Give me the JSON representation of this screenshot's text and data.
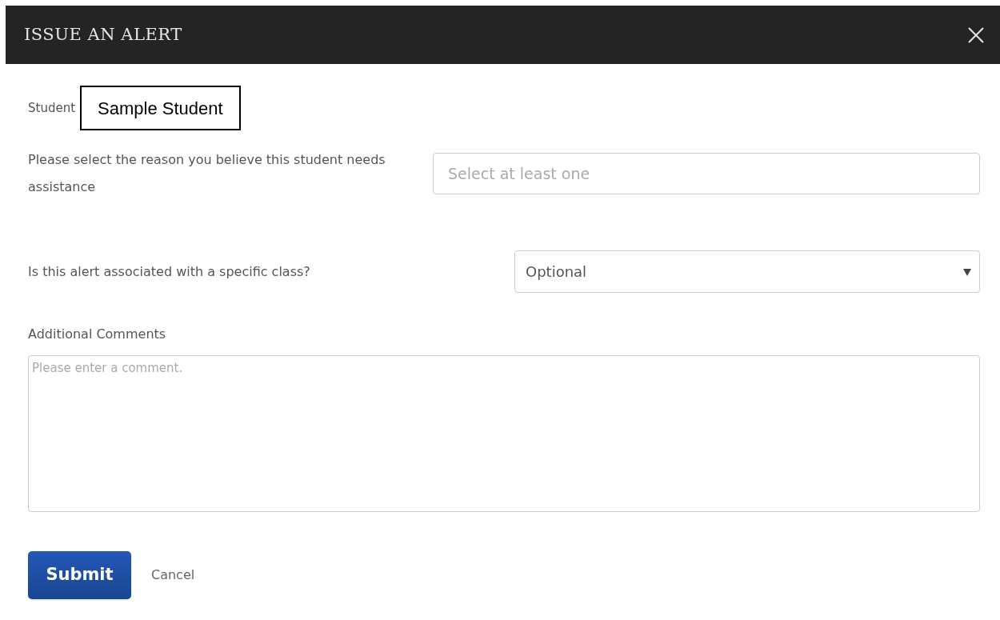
{
  "dialog": {
    "title": "ISSUE AN ALERT"
  },
  "student": {
    "label": "Student",
    "value": "Sample Student"
  },
  "reason": {
    "label": "Please select the reason you believe this student needs assistance",
    "placeholder": "Select at least one"
  },
  "class_select": {
    "label": "Is this alert associated with a specific class?",
    "value": "Optional"
  },
  "comments": {
    "label": "Additional Comments",
    "placeholder": "Please enter a comment."
  },
  "buttons": {
    "submit": "Submit",
    "cancel": "Cancel"
  }
}
